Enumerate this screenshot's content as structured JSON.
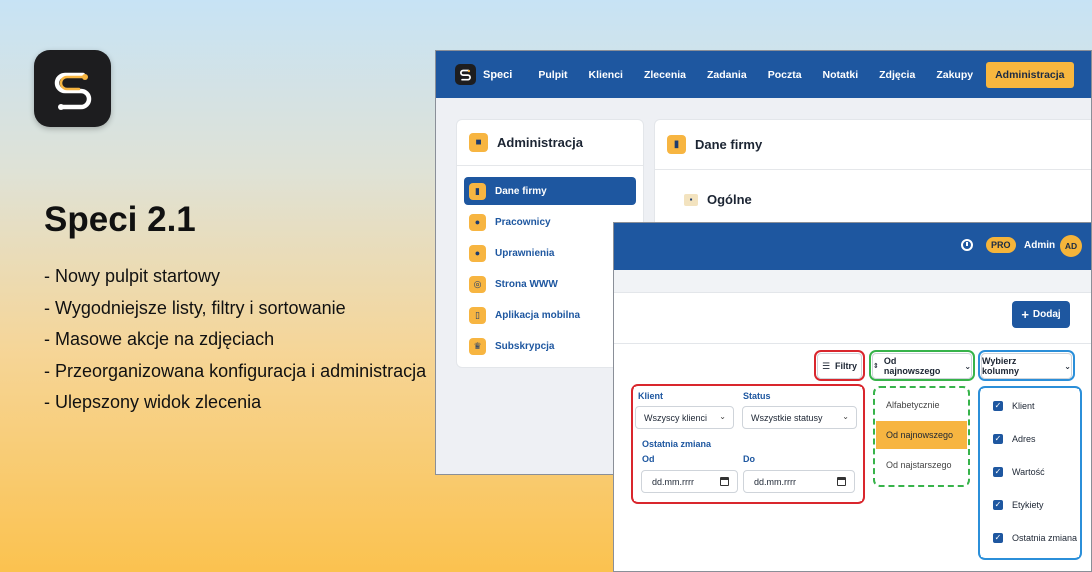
{
  "promo": {
    "title": "Speci 2.1",
    "features": [
      "- Nowy pulpit startowy",
      "- Wygodniejsze listy, filtry i sortowanie",
      "- Masowe akcje na zdjęciach",
      "- Przeorganizowana konfiguracja i administracja",
      "- Ulepszony widok zlecenia"
    ]
  },
  "nav": {
    "brand": "Speci",
    "items": [
      "Pulpit",
      "Klienci",
      "Zlecenia",
      "Zadania",
      "Poczta",
      "Notatki",
      "Zdjęcia",
      "Zakupy"
    ],
    "active": "Administracja"
  },
  "sidebar": {
    "title": "Administracja",
    "items": [
      {
        "label": "Dane firmy",
        "icon": "building-icon",
        "active": true
      },
      {
        "label": "Pracownicy",
        "icon": "users-icon"
      },
      {
        "label": "Uprawnienia",
        "icon": "user-key-icon"
      },
      {
        "label": "Strona WWW",
        "icon": "globe-icon"
      },
      {
        "label": "Aplikacja mobilna",
        "icon": "mobile-icon"
      },
      {
        "label": "Subskrypcja",
        "icon": "crown-icon"
      }
    ]
  },
  "main": {
    "title": "Dane firmy",
    "section": "Ogólne"
  },
  "topbar2": {
    "badge": "PRO",
    "user": "Admin",
    "avatar": "AD"
  },
  "list": {
    "add_label": "Dodaj",
    "filters_label": "Filtry",
    "sort_label": "Od najnowszego",
    "columns_label": "Wybierz kolumny"
  },
  "filters": {
    "client_label": "Klient",
    "client_value": "Wszyscy klienci",
    "status_label": "Status",
    "status_value": "Wszystkie statusy",
    "last_change_label": "Ostatnia zmiana",
    "from_label": "Od",
    "to_label": "Do",
    "date_placeholder": "dd.mm.rrrr"
  },
  "sort_options": [
    {
      "label": "Alfabetycznie"
    },
    {
      "label": "Od najnowszego",
      "selected": true
    },
    {
      "label": "Od najstarszego"
    }
  ],
  "columns": [
    "Klient",
    "Adres",
    "Wartość",
    "Etykiety",
    "Ostatnia zmiana"
  ],
  "colors": {
    "primary": "#1e57a0",
    "accent": "#f7b541",
    "highlight_red": "#d9262d",
    "highlight_green": "#37b34a",
    "highlight_blue": "#2b8fd9"
  }
}
